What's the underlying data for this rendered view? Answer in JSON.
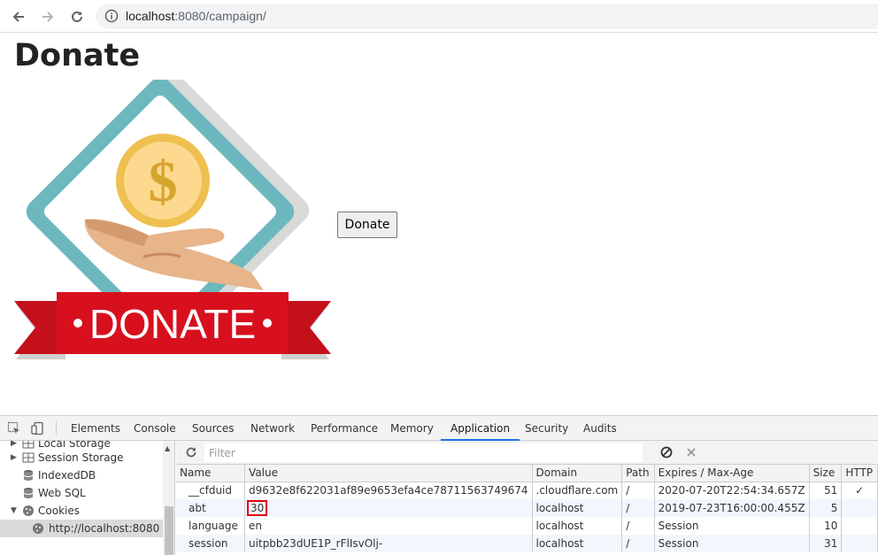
{
  "browser": {
    "url_host": "localhost",
    "url_rest": ":8080/campaign/"
  },
  "page": {
    "title": "Donate",
    "image_text": "DONATE",
    "donate_button": "Donate"
  },
  "devtools": {
    "tabs": [
      "Elements",
      "Console",
      "Sources",
      "Network",
      "Performance",
      "Memory",
      "Application",
      "Security",
      "Audits"
    ],
    "active_tab": "Application",
    "sidebar": {
      "cut_item": "Local Storage",
      "items": [
        "Session Storage",
        "IndexedDB",
        "Web SQL",
        "Cookies",
        "http://localhost:8080"
      ]
    },
    "filter_placeholder": "Filter",
    "columns": [
      "Name",
      "Value",
      "Domain",
      "Path",
      "Expires / Max-Age",
      "Size",
      "HTTP"
    ],
    "rows": [
      {
        "name": "__cfduid",
        "value": "d9632e8f622031af89e9653efa4ce78711563749674",
        "domain": ".cloudflare.com",
        "path": "/",
        "expires": "2020-07-20T22:54:34.657Z",
        "size": "51",
        "http": "✓"
      },
      {
        "name": "abt",
        "value": "30",
        "domain": "localhost",
        "path": "/",
        "expires": "2019-07-23T16:00:00.455Z",
        "size": "5",
        "http": ""
      },
      {
        "name": "language",
        "value": "en",
        "domain": "localhost",
        "path": "/",
        "expires": "Session",
        "size": "10",
        "http": ""
      },
      {
        "name": "session",
        "value": "uitpbb23dUE1P_rFlIsvOlj-",
        "domain": "localhost",
        "path": "/",
        "expires": "Session",
        "size": "31",
        "http": ""
      }
    ]
  },
  "colors": {
    "ribbon_red": "#d8101e",
    "diamond_teal": "#6cb8be",
    "coin_gold": "#f2c55c",
    "active_tab_blue": "#1a73e8",
    "highlight_red": "#e0000f"
  }
}
